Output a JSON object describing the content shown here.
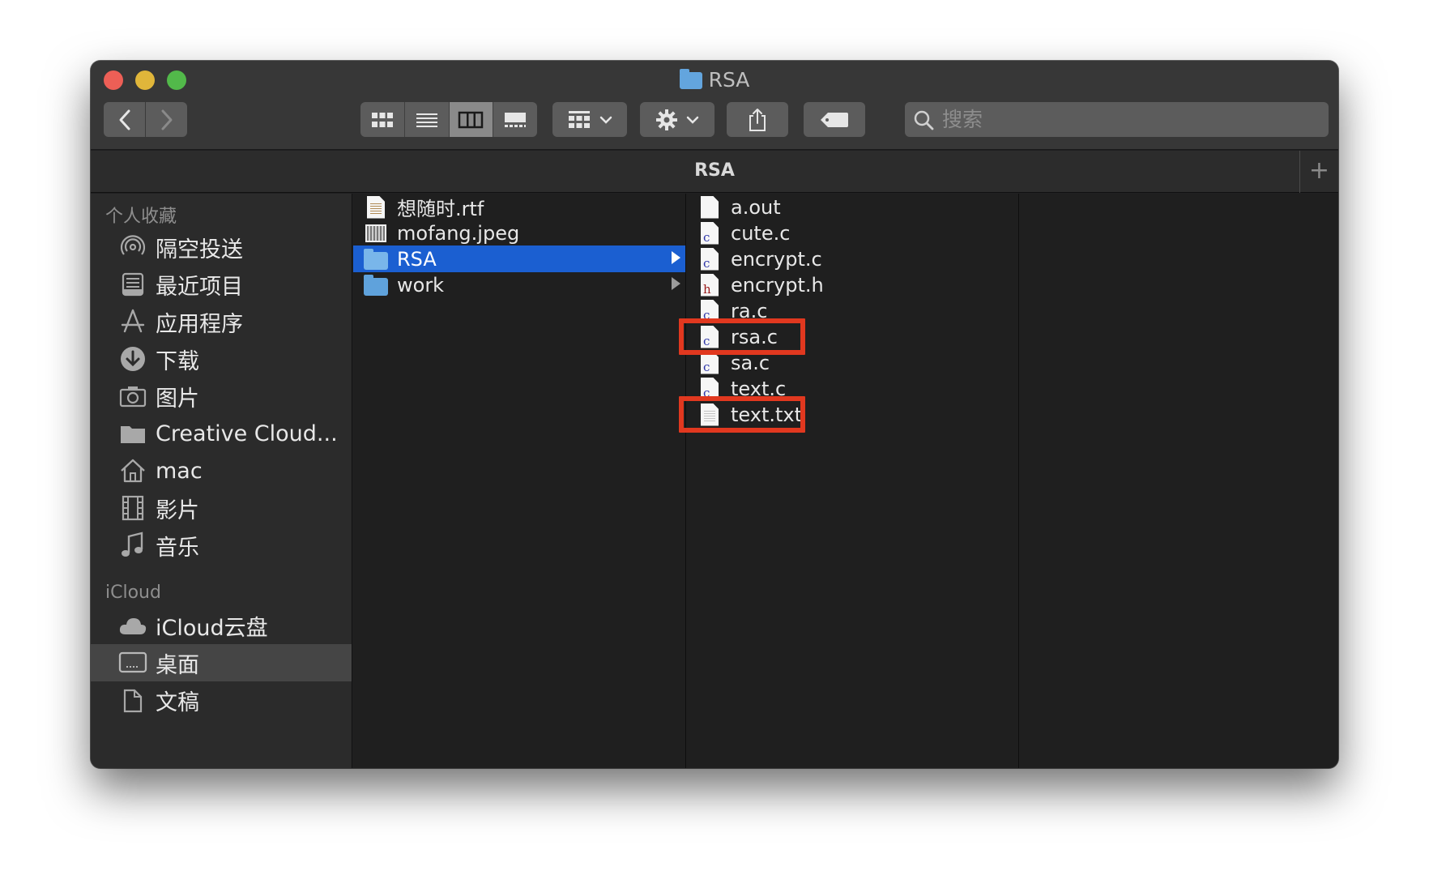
{
  "window": {
    "title": "RSA"
  },
  "toolbar": {
    "back_icon": "chevron-left-icon",
    "forward_icon": "chevron-right-icon",
    "view_modes": [
      "icon-view",
      "list-view",
      "column-view",
      "gallery-view"
    ],
    "active_view": "column-view",
    "group_icon": "group-grid-icon",
    "action_icon": "gear-icon",
    "share_icon": "share-icon",
    "tag_icon": "tag-icon",
    "search_placeholder": "搜索"
  },
  "pathbar": {
    "title": "RSA",
    "add_label": "+"
  },
  "sidebar": {
    "sections": [
      {
        "heading": "个人收藏"
      },
      {
        "heading": "iCloud"
      }
    ],
    "favorites": [
      {
        "label": "隔空投送",
        "icon": "airdrop-icon"
      },
      {
        "label": "最近项目",
        "icon": "recents-icon"
      },
      {
        "label": "应用程序",
        "icon": "applications-icon"
      },
      {
        "label": "下载",
        "icon": "downloads-icon"
      },
      {
        "label": "图片",
        "icon": "camera-icon"
      },
      {
        "label": "Creative Cloud...",
        "icon": "folder-icon"
      },
      {
        "label": "mac",
        "icon": "home-icon"
      },
      {
        "label": "影片",
        "icon": "film-icon"
      },
      {
        "label": "音乐",
        "icon": "music-note-icon"
      }
    ],
    "icloud": [
      {
        "label": "iCloud云盘",
        "icon": "cloud-icon"
      },
      {
        "label": "桌面",
        "icon": "desktop-icon",
        "selected": true
      },
      {
        "label": "文稿",
        "icon": "documents-icon"
      }
    ]
  },
  "column1": [
    {
      "name": "想随时.rtf",
      "kind": "rtf"
    },
    {
      "name": "mofang.jpeg",
      "kind": "image"
    },
    {
      "name": "RSA",
      "kind": "folder",
      "selected": true
    },
    {
      "name": "work",
      "kind": "folder"
    }
  ],
  "column2": [
    {
      "name": "a.out",
      "kind": "blank"
    },
    {
      "name": "cute.c",
      "kind": "c"
    },
    {
      "name": "encrypt.c",
      "kind": "c"
    },
    {
      "name": "encrypt.h",
      "kind": "h"
    },
    {
      "name": "ra.c",
      "kind": "c"
    },
    {
      "name": "rsa.c",
      "kind": "c",
      "highlighted": true
    },
    {
      "name": "sa.c",
      "kind": "c"
    },
    {
      "name": "text.c",
      "kind": "c"
    },
    {
      "name": "text.txt",
      "kind": "txt",
      "highlighted": true
    }
  ],
  "doc_letters": {
    "c": "c",
    "h": "h"
  },
  "colors": {
    "selection": "#1b5fd1",
    "highlight_box": "#e1381f",
    "folder": "#5fa2dc"
  }
}
